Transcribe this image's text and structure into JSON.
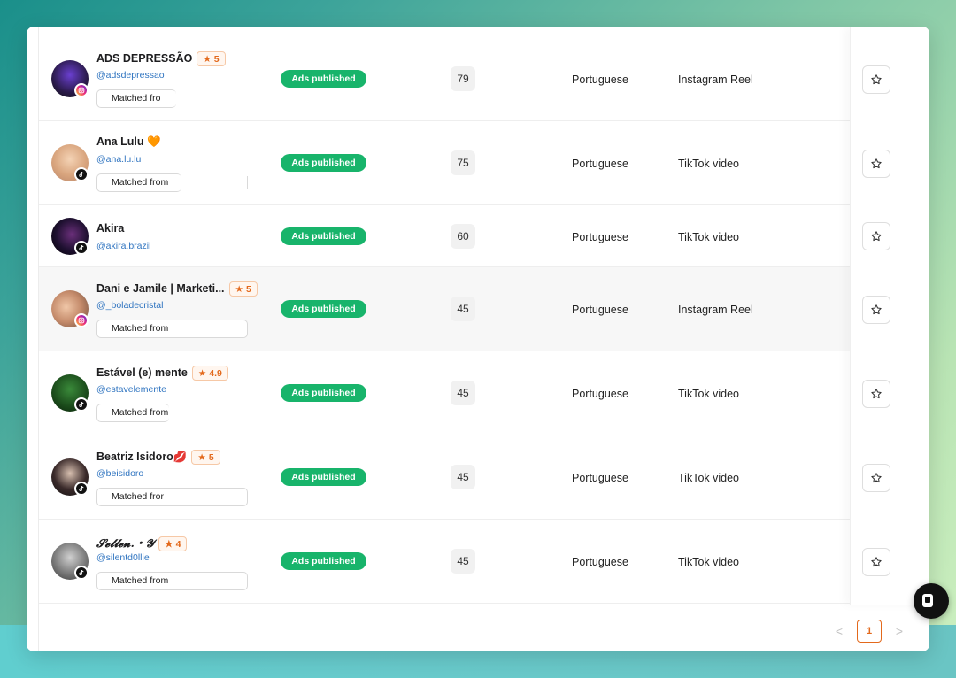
{
  "colors": {
    "accent": "#e3691c",
    "status_green": "#18b46b",
    "handle_blue": "#2f74c0"
  },
  "rows": [
    {
      "name": "ADS DEPRESSÃO",
      "emoji": "",
      "rating": "5",
      "handle": "@adsdepressao",
      "platform": "instagram",
      "matched": "Matched fro",
      "status": "Ads published",
      "count": "79",
      "language": "Portuguese",
      "format": "Instagram Reel"
    },
    {
      "name": "Ana Lulu",
      "emoji": "🧡",
      "rating": "",
      "handle": "@ana.lu.lu",
      "platform": "tiktok",
      "matched": "Matched from",
      "status": "Ads published",
      "count": "75",
      "language": "Portuguese",
      "format": "TikTok video"
    },
    {
      "name": "Akira",
      "emoji": "",
      "rating": "",
      "handle": "@akira.brazil",
      "platform": "tiktok",
      "matched": "",
      "status": "Ads published",
      "count": "60",
      "language": "Portuguese",
      "format": "TikTok video"
    },
    {
      "name": "Dani e Jamile | Marketi...",
      "emoji": "",
      "rating": "5",
      "handle": "@_boladecristal",
      "platform": "instagram",
      "matched": "Matched from",
      "status": "Ads published",
      "count": "45",
      "language": "Portuguese",
      "format": "Instagram Reel"
    },
    {
      "name": "Estável (e) mente",
      "emoji": "",
      "rating": "4.9",
      "handle": "@estavelemente",
      "platform": "tiktok",
      "matched": "Matched from",
      "status": "Ads published",
      "count": "45",
      "language": "Portuguese",
      "format": "TikTok video"
    },
    {
      "name": "Beatriz Isidoro",
      "emoji": "💋",
      "rating": "5",
      "handle": "@beisidoro",
      "platform": "tiktok",
      "matched": "Matched fror",
      "status": "Ads published",
      "count": "45",
      "language": "Portuguese",
      "format": "TikTok video"
    },
    {
      "name": "𝓢𝓮𝓵𝓵𝓮𝓷.・𝓨",
      "emoji": "",
      "rating": "4",
      "handle": "@silentd0llie",
      "platform": "tiktok",
      "matched": "Matched from",
      "status": "Ads published",
      "count": "45",
      "language": "Portuguese",
      "format": "TikTok video"
    }
  ],
  "pagination": {
    "prev": "<",
    "current": "1",
    "next": ">"
  }
}
